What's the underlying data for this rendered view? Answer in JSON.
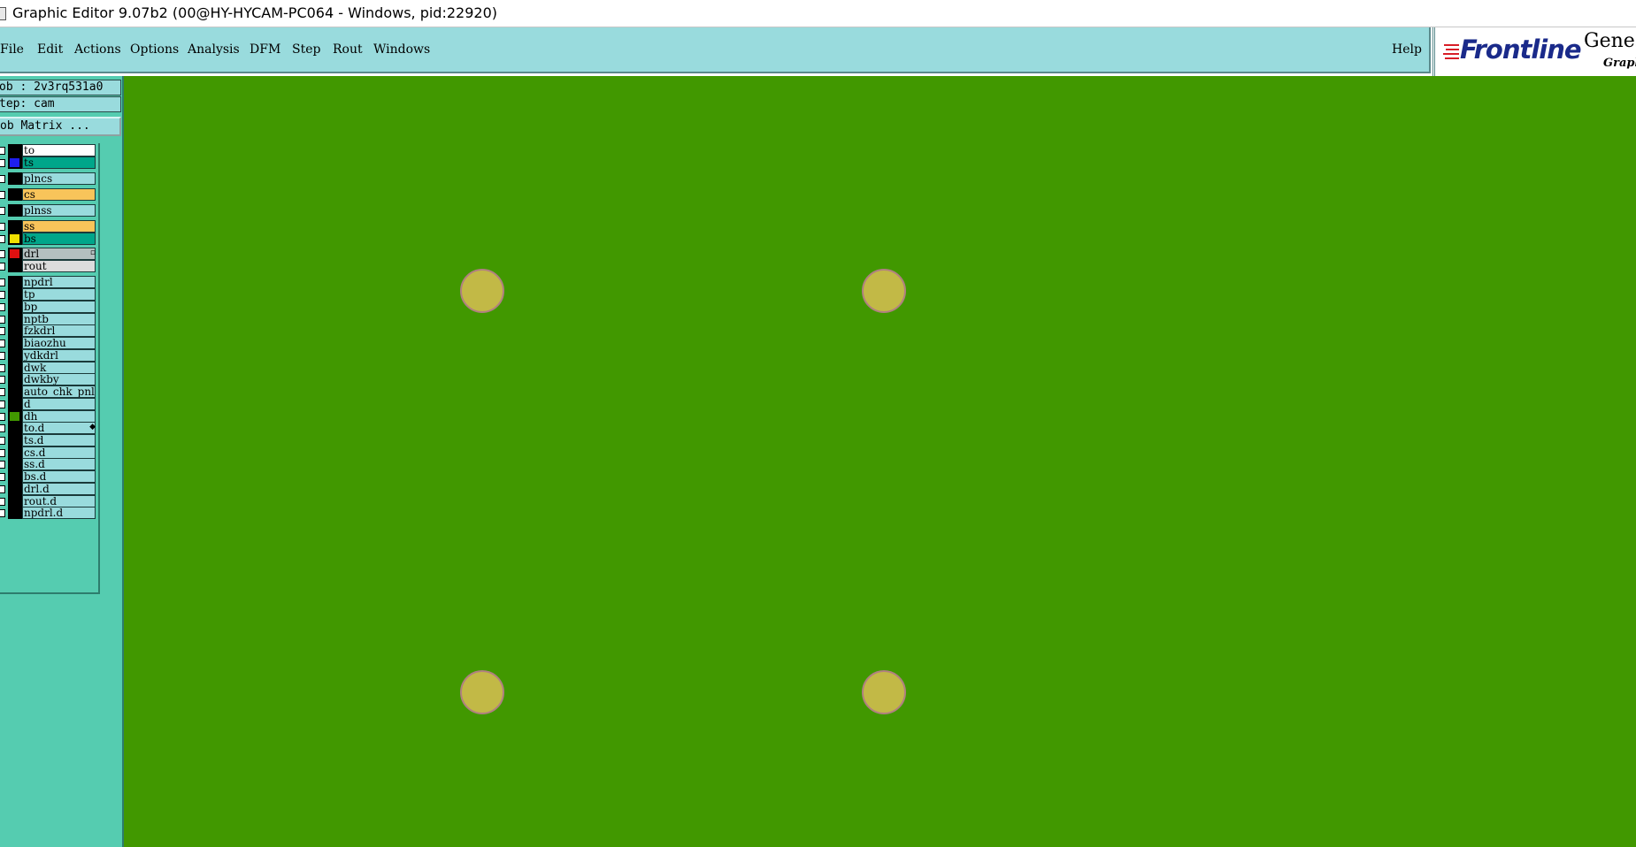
{
  "window": {
    "title": "Graphic Editor 9.07b2 (00@HY-HYCAM-PC064 - Windows, pid:22920)"
  },
  "menu": {
    "file": "File",
    "edit": "Edit",
    "actions": "Actions",
    "options": "Options",
    "analysis": "Analysis",
    "dfm": "DFM",
    "step": "Step",
    "rout": "Rout",
    "windows": "Windows",
    "help": "Help"
  },
  "logo": {
    "brand": "Frontline",
    "product": "Genes",
    "subtitle": "Graph"
  },
  "job": {
    "job_line": "ob : 2v3rq531a0",
    "step_line": "tep: cam",
    "matrix_button": "ob Matrix ..."
  },
  "layers": [
    {
      "name": "to",
      "bg": "#ffffff",
      "swatch": "#000000"
    },
    {
      "name": "ts",
      "bg": "#00a68a",
      "swatch": "#1e1ef0"
    },
    {
      "name": "plncs",
      "bg": "#99dbdd",
      "swatch": "#000000"
    },
    {
      "name": "cs",
      "bg": "#f8c45a",
      "swatch": "#000000"
    },
    {
      "name": "plnss",
      "bg": "#99dbdd",
      "swatch": "#000000"
    },
    {
      "name": "ss",
      "bg": "#f8c45a",
      "swatch": "#000000"
    },
    {
      "name": "bs",
      "bg": "#00a68a",
      "swatch": "#f0e000"
    },
    {
      "name": "drl",
      "bg": "#b4c0c0",
      "swatch": "#e01010",
      "mark": "▫"
    },
    {
      "name": "rout",
      "bg": "#dcdcdc",
      "swatch": "#000000"
    },
    {
      "name": "npdrl",
      "bg": "#99dbdd",
      "swatch": "#000000"
    },
    {
      "name": "tp",
      "bg": "#99dbdd",
      "swatch": "#000000"
    },
    {
      "name": "bp",
      "bg": "#99dbdd",
      "swatch": "#000000"
    },
    {
      "name": "nptb",
      "bg": "#99dbdd",
      "swatch": "#000000"
    },
    {
      "name": "fzkdrl",
      "bg": "#99dbdd",
      "swatch": "#000000"
    },
    {
      "name": "biaozhu",
      "bg": "#99dbdd",
      "swatch": "#000000"
    },
    {
      "name": "ydkdrl",
      "bg": "#99dbdd",
      "swatch": "#000000"
    },
    {
      "name": "dwk",
      "bg": "#99dbdd",
      "swatch": "#000000"
    },
    {
      "name": "dwkby",
      "bg": "#99dbdd",
      "swatch": "#000000"
    },
    {
      "name": "auto_chk_pnl",
      "bg": "#99dbdd",
      "swatch": "#000000"
    },
    {
      "name": "d",
      "bg": "#99dbdd",
      "swatch": "#000000"
    },
    {
      "name": "dh",
      "bg": "#99dbdd",
      "swatch": "#419800"
    },
    {
      "name": "to.d",
      "bg": "#99dbdd",
      "swatch": "#000000",
      "mark": "◆"
    },
    {
      "name": "ts.d",
      "bg": "#99dbdd",
      "swatch": "#000000"
    },
    {
      "name": "cs.d",
      "bg": "#99dbdd",
      "swatch": "#000000"
    },
    {
      "name": "ss.d",
      "bg": "#99dbdd",
      "swatch": "#000000"
    },
    {
      "name": "bs.d",
      "bg": "#99dbdd",
      "swatch": "#000000"
    },
    {
      "name": "drl.d",
      "bg": "#99dbdd",
      "swatch": "#000000"
    },
    {
      "name": "rout.d",
      "bg": "#99dbdd",
      "swatch": "#000000"
    },
    {
      "name": "npdrl.d",
      "bg": "#99dbdd",
      "swatch": "#000000"
    }
  ],
  "canvas": {
    "background": "#419800",
    "pad_color": "#c2b946",
    "pad_count": 4
  }
}
